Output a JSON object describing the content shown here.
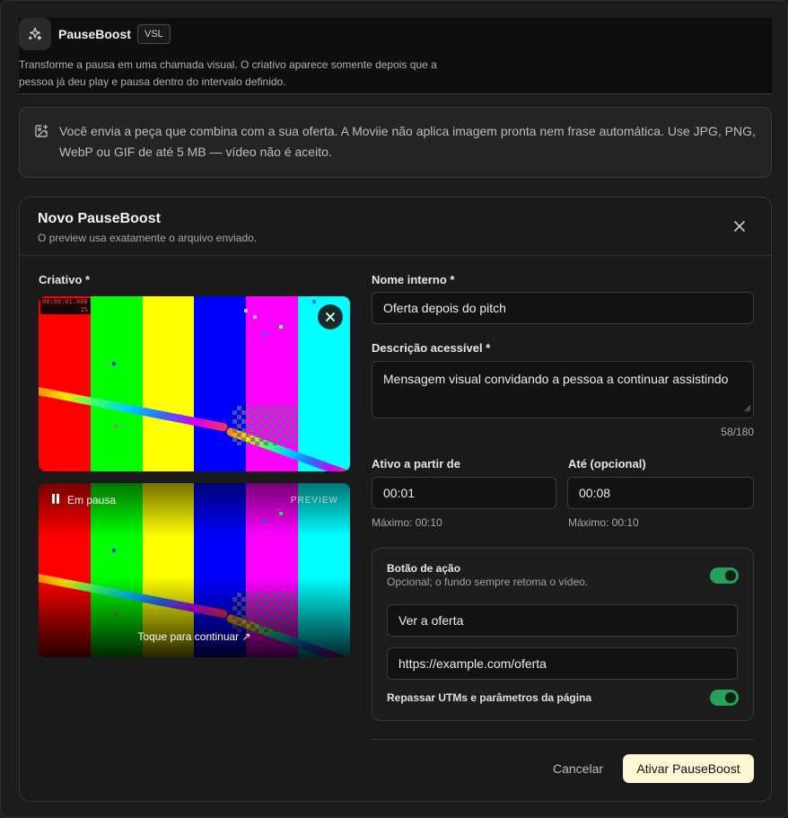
{
  "app": {
    "title": "PauseBoost",
    "badge": "VSL",
    "subtitle": "Transforme a pausa em uma chamada visual. O criativo aparece somente depois que a pessoa já deu play e pausa dentro do intervalo definido.",
    "icon": "sparkles-icon"
  },
  "note": {
    "icon": "image-upload-icon",
    "text": "Você envia a peça que combina com a sua oferta. A Moviie não aplica imagem pronta nem frase automática. Use JPG, PNG, WebP ou GIF de até 5 MB — vídeo não é aceito."
  },
  "dialog": {
    "title": "Novo PauseBoost",
    "subtitle": "O preview usa exatamente o arquivo enviado.",
    "close_icon": "close-icon"
  },
  "creative": {
    "label": "Criativo *",
    "timecode": "00:00:01.000",
    "timecode_pct": "1%",
    "preview": {
      "paused_label": "Em pausa",
      "preview_tag": "PREVIEW",
      "cta": "Toque para continuar ↗"
    },
    "colors": [
      "#ff0000",
      "#00ff00",
      "#ffff00",
      "#0000ff",
      "#ff00ff",
      "#00ffff"
    ]
  },
  "form": {
    "internal_name": {
      "label": "Nome interno *",
      "value": "Oferta depois do pitch"
    },
    "description": {
      "label": "Descrição acessível *",
      "value": "Mensagem visual convidando a pessoa a continuar assistindo",
      "counter": "58/180"
    },
    "start": {
      "label": "Ativo a partir de",
      "value": "00:01",
      "hint": "Máximo: 00:10"
    },
    "end": {
      "label": "Até (opcional)",
      "value": "00:08",
      "hint": "Máximo: 00:10"
    },
    "action": {
      "title": "Botão de ação",
      "subtitle": "Opcional; o fundo sempre retoma o vídeo.",
      "enabled": true,
      "button_text": "Ver a oferta",
      "url": "https://example.com/oferta",
      "utm_label": "Repassar UTMs e parâmetros da página",
      "utm_enabled": true
    }
  },
  "footer": {
    "cancel": "Cancelar",
    "submit": "Ativar PauseBoost"
  },
  "colors": {
    "accent_toggle": "#26a05a",
    "primary_button": "#fdf7d6"
  }
}
